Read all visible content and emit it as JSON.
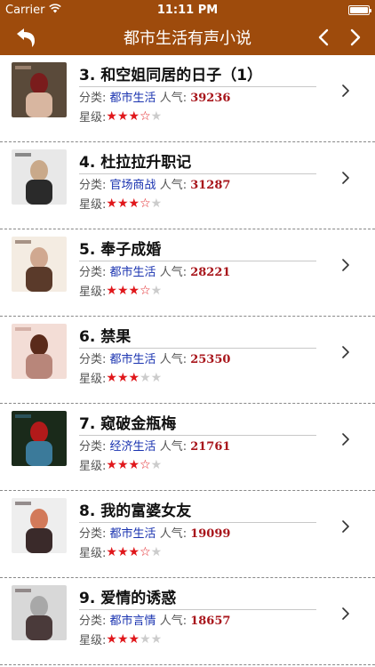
{
  "status_bar": {
    "carrier": "Carrier",
    "time": "11:11 PM",
    "battery_level": 1.0
  },
  "nav": {
    "title": "都市生活有声小说"
  },
  "labels": {
    "category_prefix": "分类:",
    "popularity_prefix": "人气:",
    "rating_prefix": "星级:"
  },
  "items": [
    {
      "title": "3. 和空姐同居的日子（1）",
      "category": "都市生活",
      "popularity": "39236",
      "stars": [
        "full",
        "full",
        "full",
        "half",
        "empty"
      ],
      "cover_colors": [
        "#5a4a3a",
        "#d8b6a0",
        "#7a1c1c"
      ]
    },
    {
      "title": "4. 杜拉拉升职记",
      "category": "官场商战",
      "popularity": "31287",
      "stars": [
        "full",
        "full",
        "full",
        "half",
        "empty"
      ],
      "cover_colors": [
        "#e8e8e8",
        "#2a2a2a",
        "#c9a98a"
      ]
    },
    {
      "title": "5. 奉子成婚",
      "category": "都市生活",
      "popularity": "28221",
      "stars": [
        "full",
        "full",
        "full",
        "half",
        "empty"
      ],
      "cover_colors": [
        "#f4ece2",
        "#5a3a2a",
        "#d0a890"
      ]
    },
    {
      "title": "6. 禁果",
      "category": "都市生活",
      "popularity": "25350",
      "stars": [
        "full",
        "full",
        "full",
        "empty",
        "empty"
      ],
      "cover_colors": [
        "#f3ddd6",
        "#b8867a",
        "#5a2a1a"
      ]
    },
    {
      "title": "7. 窥破金瓶梅",
      "category": "经济生活",
      "popularity": "21761",
      "stars": [
        "full",
        "full",
        "full",
        "half",
        "empty"
      ],
      "cover_colors": [
        "#1a2a1a",
        "#3b7a9a",
        "#b21a1a"
      ]
    },
    {
      "title": "8. 我的富婆女友",
      "category": "都市生活",
      "popularity": "19099",
      "stars": [
        "full",
        "full",
        "full",
        "half",
        "empty"
      ],
      "cover_colors": [
        "#eeeeee",
        "#3a2a2a",
        "#d27a5a"
      ]
    },
    {
      "title": "9. 爱情的诱惑",
      "category": "都市言情",
      "popularity": "18657",
      "stars": [
        "full",
        "full",
        "full",
        "empty",
        "empty"
      ],
      "cover_colors": [
        "#d8d8d8",
        "#4a3a3a",
        "#a8a8a8"
      ]
    }
  ],
  "colors": {
    "accent": "#9e4b0c",
    "category": "#1a33b0",
    "popularity": "#a8151b",
    "star": "#e0171b"
  },
  "icons": {
    "back": "back-arrow-icon",
    "prev": "chevron-left-icon",
    "next": "chevron-right-icon",
    "row": "chevron-right-icon"
  }
}
